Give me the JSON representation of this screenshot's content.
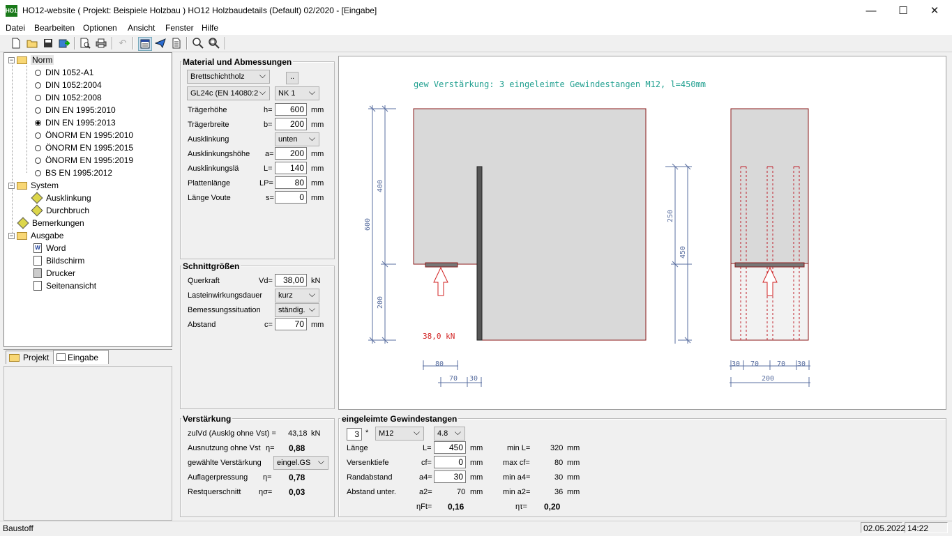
{
  "window": {
    "title": "HO12-website ( Projekt: Beispiele Holzbau ) HO12 Holzbaudetails (Default) 02/2020  - [Eingabe]",
    "icon_text": "HO12",
    "minimize": "—",
    "maximize": "☐",
    "close": "✕"
  },
  "menu": [
    "Datei",
    "Bearbeiten",
    "Optionen",
    "Ansicht",
    "Fenster",
    "Hilfe"
  ],
  "tree": {
    "norm": "Norm",
    "norm_items": [
      "DIN 1052-A1",
      "DIN 1052:2004",
      "DIN 1052:2008",
      "DIN EN 1995:2010",
      "DIN EN 1995:2013",
      "ÖNORM EN 1995:2010",
      "ÖNORM EN 1995:2015",
      "ÖNORM EN 1995:2019",
      "BS EN 1995:2012"
    ],
    "selected_norm": "DIN EN 1995:2013",
    "system": "System",
    "system_items": [
      "Ausklinkung",
      "Durchbruch"
    ],
    "bemerkungen": "Bemerkungen",
    "ausgabe": "Ausgabe",
    "ausgabe_items": [
      "Word",
      "Bildschirm",
      "Drucker",
      "Seitenansicht"
    ]
  },
  "tabs": {
    "projekt": "Projekt",
    "eingabe": "Eingabe"
  },
  "material": {
    "title": "Material und Abmessungen",
    "material_select": "Brettschichtholz",
    "dots_button": "..",
    "grade_select": "GL24c (EN 14080:2",
    "nk_select": "NK 1",
    "rows": [
      {
        "label": "Trägerhöhe",
        "sym": "h=",
        "value": "600",
        "unit": "mm"
      },
      {
        "label": "Trägerbreite",
        "sym": "b=",
        "value": "200",
        "unit": "mm"
      },
      {
        "label": "Ausklinkungshöhe",
        "sym": "a=",
        "value": "200",
        "unit": "mm"
      },
      {
        "label": "Ausklinkungslä",
        "sym": "L=",
        "value": "140",
        "unit": "mm"
      },
      {
        "label": "Plattenlänge",
        "sym": "LP=",
        "value": "80",
        "unit": "mm"
      },
      {
        "label": "Länge Voute",
        "sym": "s=",
        "value": "0",
        "unit": "mm"
      }
    ],
    "ausklinkung_label": "Ausklinkung",
    "ausklinkung_select": "unten"
  },
  "schnitt": {
    "title": "Schnittgrößen",
    "querkraft_label": "Querkraft",
    "querkraft_sym": "Vd=",
    "querkraft_value": "38,00",
    "querkraft_unit": "kN",
    "lastdauer_label": "Lasteinwirkungsdauer",
    "lastdauer_select": "kurz",
    "situation_label": "Bemessungssituation",
    "situation_select": "ständig.",
    "abstand_label": "Abstand",
    "abstand_sym": "c=",
    "abstand_value": "70",
    "abstand_unit": "mm"
  },
  "verstaerkung": {
    "title": "Verstärkung",
    "zulvd_label": "zulVd (Ausklg ohne Vst) =",
    "zulvd_value": "43,18",
    "zulvd_unit": "kN",
    "ausn_label": "Ausnutzung ohne Vst",
    "ausn_sym": "η=",
    "ausn_value": "0,88",
    "gew_label": "gewählte Verstärkung",
    "gew_select": "eingel.GS",
    "auflager_label": "Auflagerpressung",
    "auflager_sym": "η=",
    "auflager_value": "0,78",
    "rest_label": "Restquerschnitt",
    "rest_sym": "ησ=",
    "rest_value": "0,03"
  },
  "gewinde": {
    "title": "eingeleimte Gewindestangen",
    "count": "3",
    "times": "*",
    "size_select": "M12",
    "grade_select": "4.8",
    "rows": [
      {
        "label": "Länge",
        "sym": "L=",
        "value": "450",
        "unit": "mm",
        "min_label": "min L=",
        "min_value": "320",
        "min_unit": "mm"
      },
      {
        "label": "Versenktiefe",
        "sym": "cf=",
        "value": "0",
        "unit": "mm",
        "min_label": "max cf=",
        "min_value": "80",
        "min_unit": "mm"
      },
      {
        "label": "Randabstand",
        "sym": "a4=",
        "value": "30",
        "unit": "mm",
        "min_label": "min a4=",
        "min_value": "30",
        "min_unit": "mm"
      }
    ],
    "abst_label": "Abstand unter.",
    "abst_sym": "a2=",
    "abst_value": "70",
    "abst_unit": "mm",
    "abst_min_label": "min a2=",
    "abst_min_value": "36",
    "abst_min_unit": "mm",
    "eta_ft_label": "ηFt=",
    "eta_ft_value": "0,16",
    "eta_tau_label": "ητ=",
    "eta_tau_value": "0,20"
  },
  "drawing": {
    "caption": "gew Verstärkung: 3 eingeleimte Gewindestangen M12, l=450mm",
    "load_label": "38,0 kN",
    "dim_600": "600",
    "dim_400": "400",
    "dim_200": "200",
    "dim_250": "250",
    "dim_450": "450",
    "dim_80": "80",
    "dim_70": "70",
    "dim_30": "30",
    "dim_bottom_right": [
      "30",
      "70",
      "70",
      "30"
    ],
    "dim_200_right": "200",
    "colors": {
      "outline": "#8b1a1a",
      "fill": "#d9d9d9",
      "dim": "#5a6fa0",
      "text_teal": "#1f9f8f",
      "load": "#d22222"
    }
  },
  "status": {
    "left": "Baustoff",
    "date": "02.05.2022",
    "time": "14:22"
  }
}
